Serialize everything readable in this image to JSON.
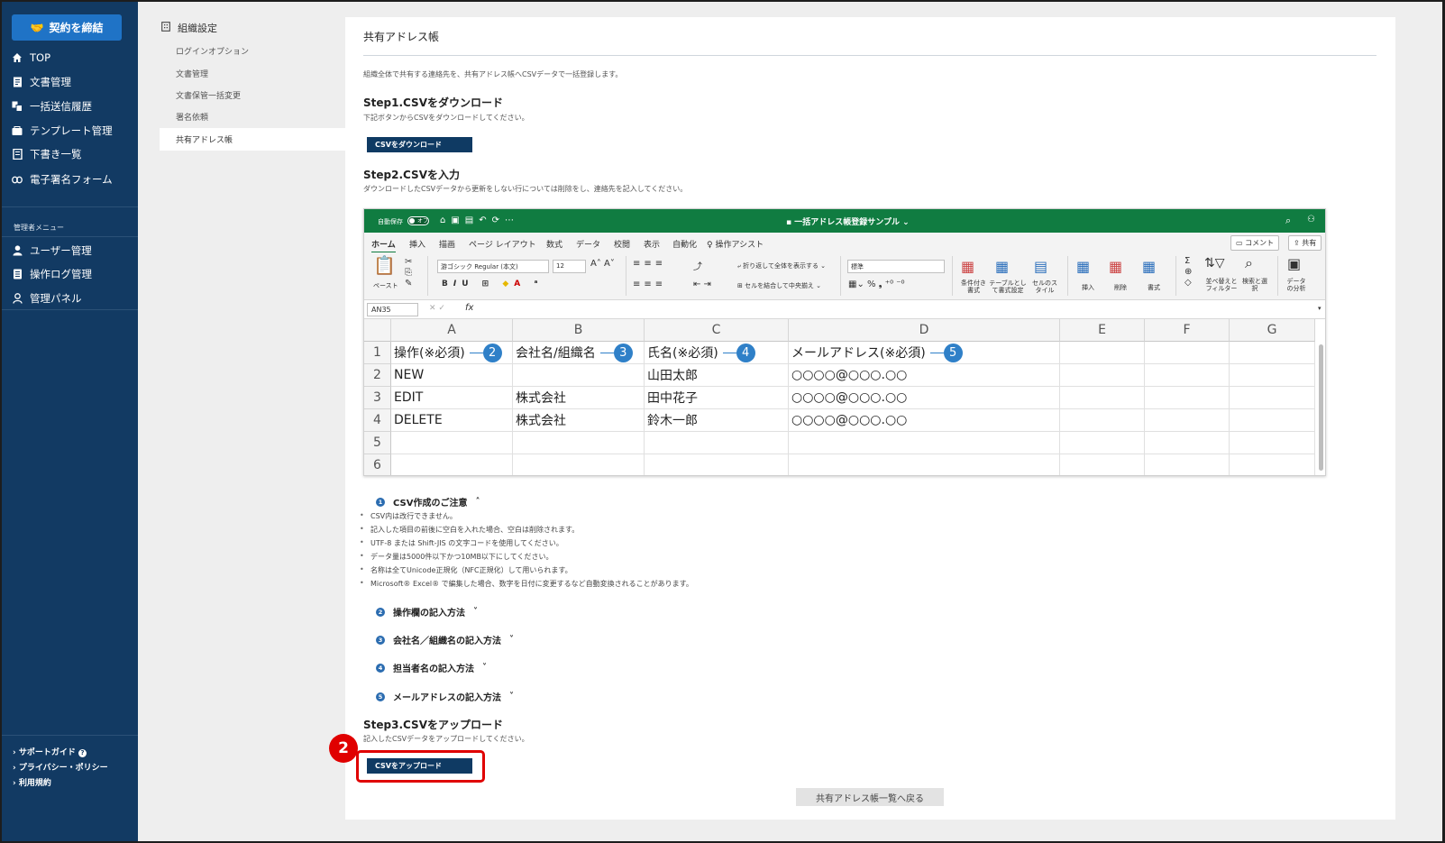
{
  "sidebar": {
    "contract_button": "契約を締結",
    "nav_items": [
      {
        "label": "TOP",
        "icon": "home-icon"
      },
      {
        "label": "文書管理",
        "icon": "document-icon"
      },
      {
        "label": "一括送信履歴",
        "icon": "bulk-send-icon"
      },
      {
        "label": "テンプレート管理",
        "icon": "template-icon"
      },
      {
        "label": "下書き一覧",
        "icon": "draft-icon"
      },
      {
        "label": "電子署名フォーム",
        "icon": "link-icon"
      }
    ],
    "admin_heading": "管理者メニュー",
    "admin_items": [
      {
        "label": "ユーザー管理",
        "icon": "user-icon"
      },
      {
        "label": "操作ログ管理",
        "icon": "log-icon"
      },
      {
        "label": "管理パネル",
        "icon": "admin-panel-icon"
      }
    ],
    "footer_links": [
      "サポートガイド",
      "プライバシー・ポリシー",
      "利用規約"
    ]
  },
  "subnav": {
    "title": "組織設定",
    "items": [
      "ログインオプション",
      "文書管理",
      "文書保管一括変更",
      "署名依頼",
      "共有アドレス帳"
    ],
    "active_index": 4
  },
  "main": {
    "title": "共有アドレス帳",
    "description": "組織全体で共有する連絡先を、共有アドレス帳へCSVデータで一括登録します。",
    "step1": {
      "title": "Step1.CSVをダウンロード",
      "desc": "下記ボタンからCSVをダウンロードしてください。",
      "button": "CSVをダウンロード"
    },
    "step2": {
      "title": "Step2.CSVを入力",
      "desc": "ダウンロードしたCSVデータから更新をしない行については削除をし、連絡先を記入してください。"
    },
    "step3": {
      "title": "Step3.CSVをアップロード",
      "desc": "記入したCSVデータをアップロードしてください。",
      "button": "CSVをアップロード"
    },
    "back_button": "共有アドレス帳一覧へ戻る",
    "highlight_number": "2"
  },
  "excel": {
    "autosave": "自動保存",
    "toggle": "オフ",
    "filename": "一括アドレス帳登録サンプル",
    "tabs": [
      "ホーム",
      "挿入",
      "描画",
      "ページ レイアウト",
      "数式",
      "データ",
      "校閲",
      "表示",
      "自動化",
      "操作アシスト"
    ],
    "comment_button": "コメント",
    "share_button": "共有",
    "ribbon": {
      "paste": "ペースト",
      "font": "游ゴシック Regular (本文)",
      "size": "12",
      "wrap": "折り返して全体を表示する",
      "merge": "セルを結合して中央揃え",
      "number_format": "標準",
      "cond_format": "条件付き書式",
      "table_format": "テーブルとして書式設定",
      "cell_style": "セルのスタイル",
      "insert": "挿入",
      "delete": "削除",
      "format": "書式",
      "sort": "並べ替えとフィルター",
      "find": "検索と選択",
      "analyze": "データの分析"
    },
    "name_box": "AN35",
    "fx": "fx",
    "columns": [
      "A",
      "B",
      "C",
      "D",
      "E",
      "F",
      "G"
    ],
    "rows": [
      "1",
      "2",
      "3",
      "4",
      "5",
      "6"
    ],
    "header_cells": [
      {
        "text": "操作(※必須)",
        "badge": "2"
      },
      {
        "text": "会社名/組織名",
        "badge": "3"
      },
      {
        "text": "氏名(※必須)",
        "badge": "4"
      },
      {
        "text": "メールアドレス(※必須)",
        "badge": "5"
      }
    ],
    "data": [
      [
        "NEW",
        "",
        "山田太郎",
        "○○○○@○○○.○○"
      ],
      [
        "EDIT",
        "株式会社",
        "田中花子",
        "○○○○@○○○.○○"
      ],
      [
        "DELETE",
        "株式会社",
        "鈴木一郎",
        "○○○○@○○○.○○"
      ]
    ]
  },
  "notes": {
    "sections": [
      {
        "num": "1",
        "title": "CSV作成のご注意",
        "expanded": true
      },
      {
        "num": "2",
        "title": "操作欄の記入方法",
        "expanded": false
      },
      {
        "num": "3",
        "title": "会社名／組織名の記入方法",
        "expanded": false
      },
      {
        "num": "4",
        "title": "担当者名の記入方法",
        "expanded": false
      },
      {
        "num": "5",
        "title": "メールアドレスの記入方法",
        "expanded": false
      }
    ],
    "bullets": [
      "CSV内は改行できません。",
      "記入した項目の前後に空白を入れた場合、空白は削除されます。",
      "UTF-8 または Shift-JIS の文字コードを使用してください。",
      "データ量は5000件以下かつ10MB以下にしてください。",
      "名称は全てUnicode正規化（NFC正規化）して用いられます。",
      "Microsoft® Excel® で編集した場合、数字を日付に変更するなど自動変換されることがあります。"
    ]
  },
  "colors": {
    "sidebar": "#123a63",
    "accent": "#1f73c6",
    "excel_green": "#107c41",
    "highlight": "#e00000"
  }
}
